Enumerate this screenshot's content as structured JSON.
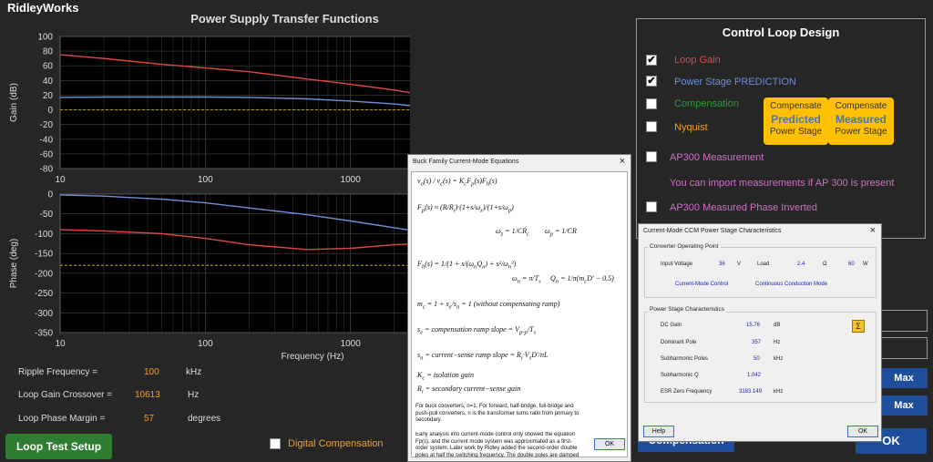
{
  "app": {
    "brand": "RidleyWorks",
    "chart_title": "Power Supply Transfer Functions"
  },
  "gain_axis": {
    "ylabel": "Gain (dB)",
    "yticks": [
      "100",
      "80",
      "60",
      "40",
      "20",
      "0",
      "-20",
      "-40",
      "-60",
      "-80"
    ]
  },
  "phase_axis": {
    "ylabel": "Phase (deg)",
    "yticks": [
      "0",
      "-50",
      "-100",
      "-150",
      "-200",
      "-250",
      "-300",
      "-350"
    ]
  },
  "x_axis": {
    "xlabel": "Frequency (Hz)",
    "xticks": [
      "10",
      "100",
      "1000",
      "10000"
    ]
  },
  "chart_data": [
    {
      "type": "line",
      "title": "Power Supply Transfer Functions",
      "xlabel": "",
      "ylabel": "Gain (dB)",
      "xscale": "log",
      "xlim": [
        10,
        30000
      ],
      "ylim": [
        -80,
        100
      ],
      "series": [
        {
          "color": "#e04848",
          "x": [
            10,
            20,
            50,
            100,
            200,
            500,
            1000,
            2000,
            5000,
            10000,
            20000,
            30000
          ],
          "values": [
            75,
            70,
            62,
            57,
            52,
            42,
            35,
            27,
            14,
            3,
            -12,
            -24
          ]
        },
        {
          "color": "#6f8fd6",
          "x": [
            10,
            20,
            50,
            100,
            200,
            500,
            1000,
            2000,
            5000,
            10000,
            20000,
            30000
          ],
          "values": [
            17,
            17.5,
            17.5,
            17.5,
            17,
            15,
            12,
            8,
            0,
            -11,
            -28,
            -41
          ]
        },
        {
          "color": "#d8c030",
          "x": [
            10,
            30000
          ],
          "values": [
            0,
            0
          ]
        }
      ]
    },
    {
      "type": "line",
      "title": "",
      "xlabel": "Frequency (Hz)",
      "ylabel": "Phase (deg)",
      "xscale": "log",
      "xlim": [
        10,
        30000
      ],
      "ylim": [
        -350,
        0
      ],
      "series": [
        {
          "color": "#e04848",
          "x": [
            10,
            20,
            50,
            100,
            200,
            500,
            1000,
            2000,
            5000,
            10000,
            20000,
            30000
          ],
          "values": [
            -90,
            -93,
            -100,
            -112,
            -128,
            -140,
            -137,
            -128,
            -122,
            -130,
            -160,
            -195
          ]
        },
        {
          "color": "#6f8fd6",
          "x": [
            10,
            20,
            50,
            100,
            200,
            500,
            1000,
            2000,
            5000,
            10000,
            20000,
            30000
          ],
          "values": [
            -2,
            -5,
            -13,
            -22,
            -35,
            -52,
            -68,
            -85,
            -108,
            -130,
            -160,
            -195
          ]
        },
        {
          "color": "#d8c030",
          "x": [
            10,
            30000
          ],
          "values": [
            -180,
            -180
          ]
        }
      ]
    }
  ],
  "results": {
    "ripple": {
      "label": "Ripple Frequency  =",
      "value": "100",
      "unit": "kHz"
    },
    "crossover": {
      "label": "Loop Gain Crossover =",
      "value": "10613",
      "unit": "Hz"
    },
    "margin": {
      "label": "Loop Phase Margin =",
      "value": "57",
      "unit": "degrees"
    }
  },
  "buttons": {
    "loop_test": "Loop Test Setup",
    "digital_comp": "Digital  Compensation",
    "compensation": "Compensation",
    "max1": "Max",
    "max2": "Max",
    "ok_main": "OK"
  },
  "control_panel": {
    "title": "Control Loop Design",
    "loop_gain": "Loop Gain",
    "power_stage": "Power Stage PREDICTION",
    "compensation": "Compensation",
    "nyquist": "Nyquist",
    "ap300": "AP300 Measurement",
    "import_msg": "You can import measurements if AP 300 is present",
    "ap300_inv": "AP300 Measured Phase Inverted",
    "comp_pred": {
      "top": "Compensate",
      "mid": "Predicted",
      "bot": "Power Stage"
    },
    "comp_meas": {
      "top": "Compensate",
      "mid": "Measured",
      "bot": "Power Stage"
    },
    "colors": {
      "loop_gain": "#e04848",
      "power_stage": "#6f8fd6",
      "compensation": "#2e9a3e",
      "nyquist": "#f0a030",
      "ap300": "#d070c8"
    }
  },
  "buck_dialog": {
    "title": "Buck Family Current-Mode Equations",
    "close": "×",
    "note1": "For buck converters, n=1. For forward, half-bridge, full-bridge and push-pull converters, n is the transformer turns ratio from primary to secondary.",
    "note2": "Early analysis into current-mode control only showed the equation Fp(s), and the current mode system was approximated as a first-order system. Later work by Ridley added the second-order double poles at half the switching frequency. The double poles are damped by the addition of the proper compensating ramp.",
    "ok": "OK"
  },
  "ccm_dialog": {
    "title": "Current-Mode CCM Power Stage Characteristics",
    "close": "×",
    "op_group": "Converter Operating Point",
    "input_voltage_label": "Input Voltage",
    "input_voltage_value": "36",
    "input_voltage_unit": "V",
    "load_label": "Load",
    "load_value": "2.4",
    "load_unit": "Ω",
    "load_power": "60",
    "load_power_unit": "W",
    "control_mode": "Current-Mode Control",
    "conduction_mode": "Continuous Conduction Mode",
    "ps_group": "Power Stage Characteristics",
    "dc_gain_label": "DC Gain",
    "dc_gain_value": "15.76",
    "dc_gain_unit": "dB",
    "dom_pole_label": "Dominant Pole",
    "dom_pole_value": "357",
    "dom_pole_unit": "Hz",
    "subh_poles_label": "Subharmonic Poles",
    "subh_poles_value": "50",
    "subh_poles_unit": "kHz",
    "subh_q_label": "Subharmonic Q",
    "subh_q_value": "1.042",
    "esr_label": "ESR Zero Frequency",
    "esr_value": "3183.149",
    "esr_unit": "kHz",
    "help": "Help",
    "ok": "OK"
  }
}
